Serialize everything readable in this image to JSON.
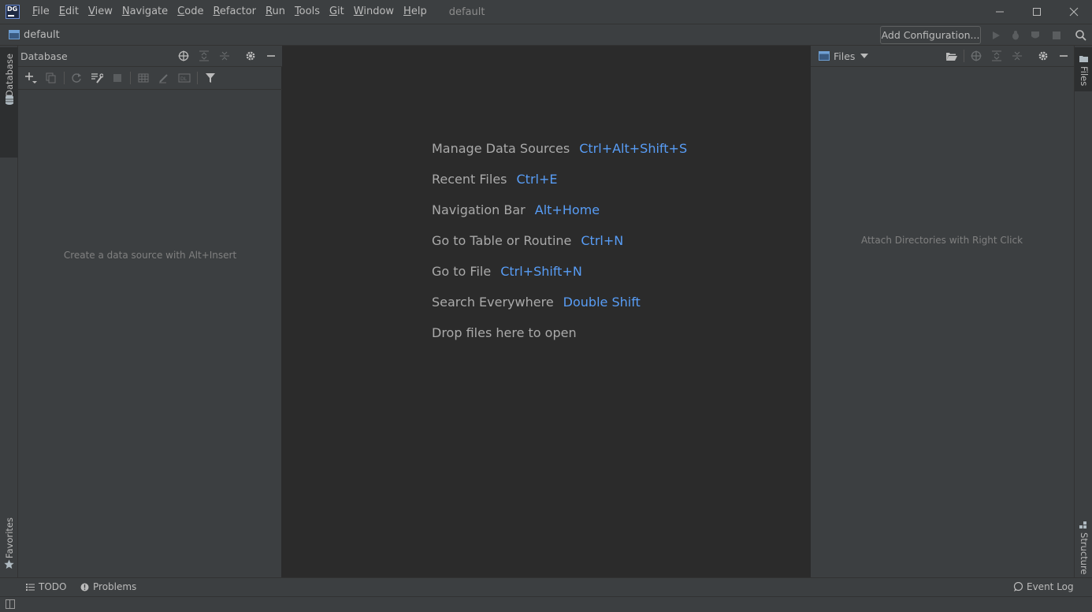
{
  "app": {
    "logo_text": "DG",
    "project_title": "default"
  },
  "menu": [
    {
      "label": "File",
      "mnemonic": "F",
      "rest": "ile"
    },
    {
      "label": "Edit",
      "mnemonic": "E",
      "rest": "dit"
    },
    {
      "label": "View",
      "mnemonic": "V",
      "rest": "iew"
    },
    {
      "label": "Navigate",
      "mnemonic": "N",
      "rest": "avigate"
    },
    {
      "label": "Code",
      "mnemonic": "C",
      "rest": "ode"
    },
    {
      "label": "Refactor",
      "mnemonic": "R",
      "rest": "efactor"
    },
    {
      "label": "Run",
      "mnemonic": "R",
      "rest": "un"
    },
    {
      "label": "Tools",
      "mnemonic": "T",
      "rest": "ools"
    },
    {
      "label": "Git",
      "mnemonic": "G",
      "rest": "it"
    },
    {
      "label": "Window",
      "mnemonic": "W",
      "rest": "indow"
    },
    {
      "label": "Help",
      "mnemonic": "H",
      "rest": "elp"
    }
  ],
  "navbar": {
    "project_label": "default",
    "add_config_label": "Add Configuration..."
  },
  "left_stripe": {
    "database_label": "Database",
    "favorites_label": "Favorites"
  },
  "db_panel": {
    "title": "Database",
    "empty_text": "Create a data source with Alt+Insert"
  },
  "editor": {
    "hints": [
      {
        "label": "Manage Data Sources",
        "key": "Ctrl+Alt+Shift+S"
      },
      {
        "label": "Recent Files",
        "key": "Ctrl+E"
      },
      {
        "label": "Navigation Bar",
        "key": "Alt+Home"
      },
      {
        "label": "Go to Table or Routine",
        "key": "Ctrl+N"
      },
      {
        "label": "Go to File",
        "key": "Ctrl+Shift+N"
      },
      {
        "label": "Search Everywhere",
        "key": "Double Shift"
      },
      {
        "label": "Drop files here to open",
        "key": ""
      }
    ]
  },
  "files_panel": {
    "title": "Files",
    "empty_text": "Attach Directories with Right Click"
  },
  "right_stripe": {
    "files_label": "Files",
    "structure_label": "Structure"
  },
  "bottom_bar": {
    "todo_label": "TODO",
    "problems_label": "Problems",
    "event_log_label": "Event Log"
  },
  "colors": {
    "accent_key": "#589df6",
    "editor_bg": "#2b2b2b",
    "panel_bg": "#3c3f41"
  }
}
